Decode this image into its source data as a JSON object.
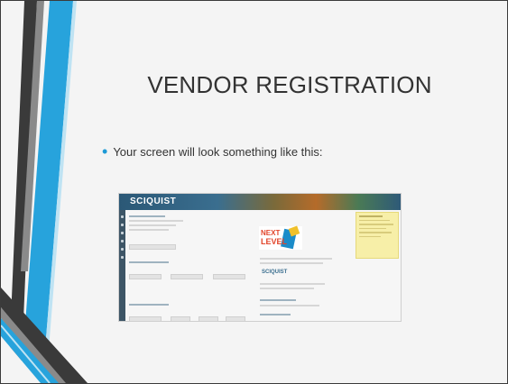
{
  "slide": {
    "title": "VENDOR REGISTRATION",
    "bullet": "Your screen will look something like this:",
    "accent_colors": {
      "light_blue": "#27a3dc",
      "dark_gray": "#3a3a3a",
      "mid_gray": "#8a8a8a",
      "bullet": "#1d9ad6"
    }
  },
  "screenshot": {
    "logo": "SCIQUIST",
    "promo_line1": "NEXT",
    "promo_line2": "LEVEL",
    "secondary_logo": "SCIQUIST"
  }
}
